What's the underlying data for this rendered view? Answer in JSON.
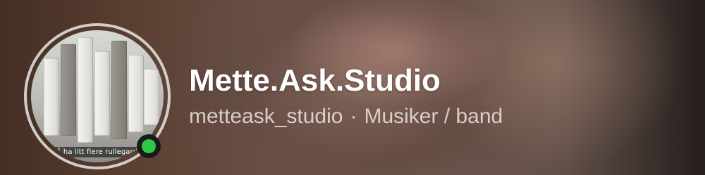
{
  "profile": {
    "display_name": "Mette.Ask.Studio",
    "username": "metteask_studio",
    "separator": "·",
    "category": "Musiker / band",
    "story_caption": "Må ha litt flere rullegardin",
    "online_status_color": "#2ec846",
    "status_icon": "online-status-dot"
  },
  "colors": {
    "name_text": "#ffffff",
    "sub_text": "#ebe4e0",
    "online_dot": "#2ec846"
  }
}
